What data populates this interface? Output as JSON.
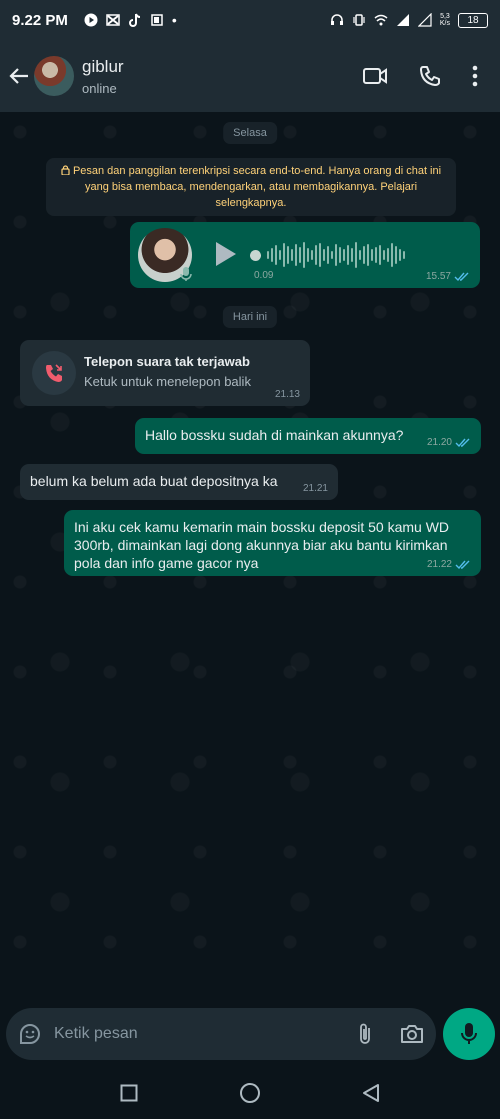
{
  "status_bar": {
    "time": "9.22 PM",
    "net_speed_top": "5,3",
    "net_speed_bottom": "K/s",
    "battery": "18"
  },
  "header": {
    "contact_name": "giblur",
    "contact_status": "online"
  },
  "chat": {
    "date_yesterday": "Selasa",
    "encryption_notice": "Pesan dan panggilan terenkripsi secara end-to-end. Hanya orang di chat ini yang bisa membaca, mendengarkan, atau membagikannya. Pelajari selengkapnya.",
    "voice_note": {
      "duration": "0.09",
      "time": "15.57"
    },
    "date_today": "Hari ini",
    "missed_call": {
      "title": "Telepon suara tak terjawab",
      "subtitle": "Ketuk untuk menelepon balik",
      "time": "21.13"
    },
    "messages": [
      {
        "text": "Hallo bossku sudah di mainkan akunnya?",
        "time": "21.20"
      },
      {
        "text": "belum ka belum ada buat depositnya ka",
        "time": "21.21"
      },
      {
        "text": "Ini aku cek kamu kemarin main bossku deposit 50 kamu WD 300rb, dimainkan lagi dong akunnya biar aku bantu kirimkan pola dan info game gacor nya",
        "time": "21.22"
      }
    ]
  },
  "input": {
    "placeholder": "Ketik pesan"
  },
  "colors": {
    "outgoing_bubble": "#005c4b",
    "incoming_bubble": "#202c33",
    "accent": "#00a884",
    "read_tick": "#53bdeb"
  }
}
